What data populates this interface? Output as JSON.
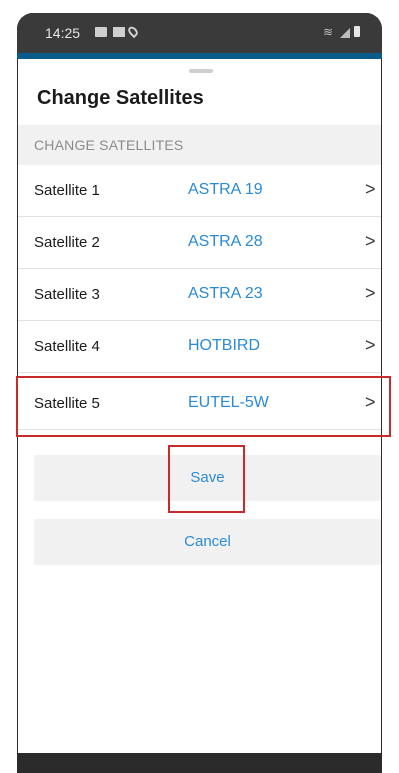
{
  "status_bar": {
    "time": "14:25",
    "icons": [
      "image-icon",
      "cast-icon",
      "location-icon",
      "wifi-icon",
      "signal-icon",
      "battery-icon"
    ]
  },
  "sheet": {
    "title": "Change Satellites",
    "section_header": "CHANGE SATELLITES",
    "rows": [
      {
        "label": "Satellite 1",
        "value": "ASTRA 19"
      },
      {
        "label": "Satellite 2",
        "value": "ASTRA 28"
      },
      {
        "label": "Satellite 3",
        "value": "ASTRA 23"
      },
      {
        "label": "Satellite 4",
        "value": "HOTBIRD"
      },
      {
        "label": "Satellite 5",
        "value": "EUTEL-5W"
      }
    ],
    "chevron": ">"
  },
  "actions": {
    "save_label": "Save",
    "cancel_label": "Cancel"
  },
  "colors": {
    "accent": "#2a8bd6",
    "highlight": "#c72b2b",
    "section_bg": "#f1f1f1"
  }
}
